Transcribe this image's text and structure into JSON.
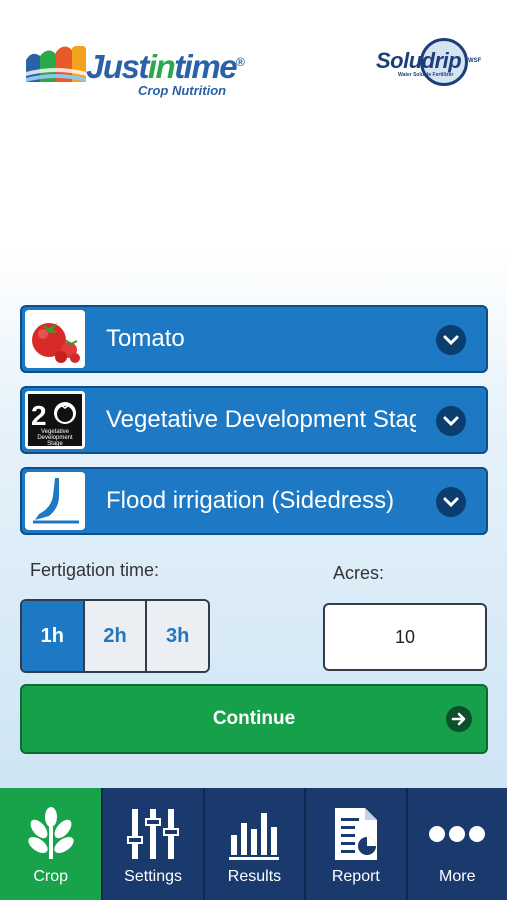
{
  "header": {
    "brand_left_main": "Justintime",
    "brand_left_highlight": "in",
    "brand_left_sub": "Crop Nutrition",
    "brand_right": "Soludrip",
    "brand_right_tag": "WSF",
    "brand_right_sub": "Water Soluble Fertilizer"
  },
  "selects": {
    "crop": {
      "label": "Tomato",
      "icon": "tomato-icon"
    },
    "stage": {
      "label": "Vegetative Development Stage",
      "icon": "stage-2-icon",
      "badge_number": "2",
      "badge_text": "Vegetative Development Stage"
    },
    "irrigation": {
      "label": "Flood irrigation (Sidedress)",
      "icon": "sidedress-blade-icon"
    }
  },
  "fertigation": {
    "label": "Fertigation time:",
    "options": [
      "1h",
      "2h",
      "3h"
    ],
    "selected": "1h"
  },
  "acres": {
    "label": "Acres:",
    "value": "10"
  },
  "continue_label": "Continue",
  "tabs": [
    {
      "label": "Crop",
      "icon": "leaf-icon",
      "active": true
    },
    {
      "label": "Settings",
      "icon": "sliders-icon",
      "active": false
    },
    {
      "label": "Results",
      "icon": "bar-chart-icon",
      "active": false
    },
    {
      "label": "Report",
      "icon": "report-document-icon",
      "active": false
    },
    {
      "label": "More",
      "icon": "more-dots-icon",
      "active": false
    }
  ],
  "colors": {
    "select_blue": "#1e79c4",
    "continue_green": "#17a04a",
    "tabbar_navy": "#1a3a6e",
    "active_tab_green": "#18a24a"
  }
}
